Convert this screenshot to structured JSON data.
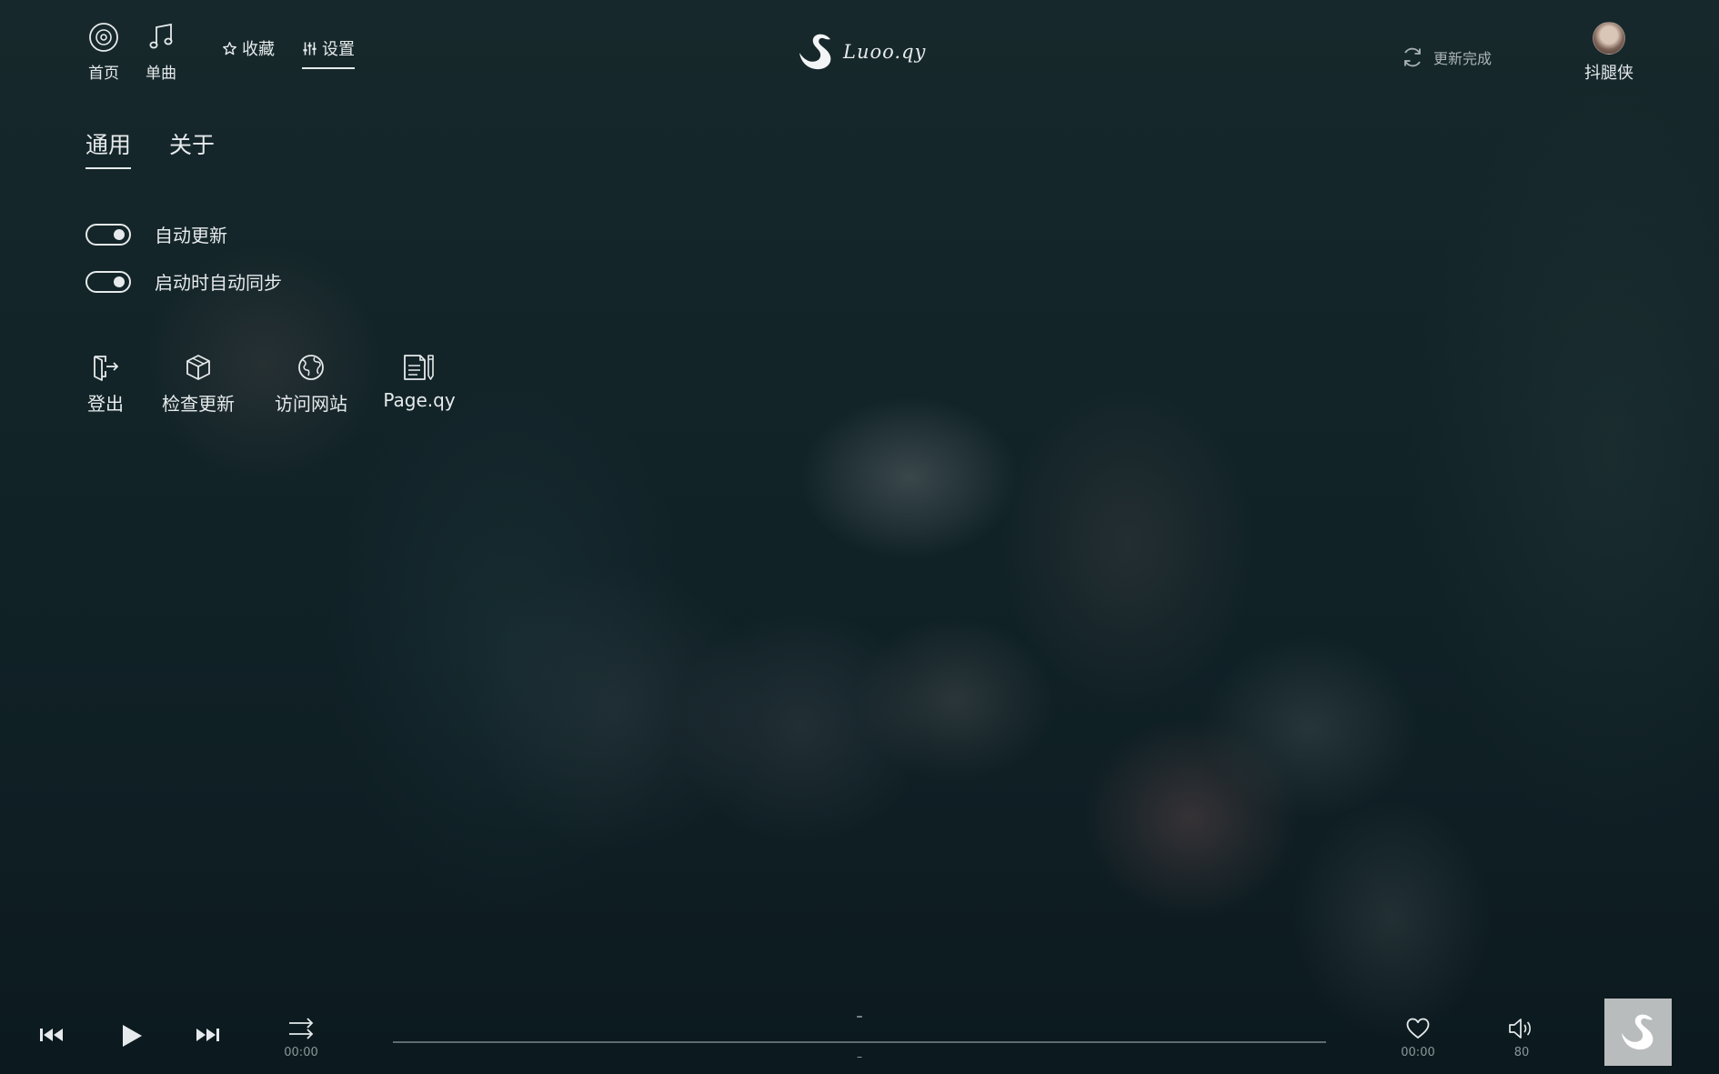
{
  "nav": {
    "home_label": "首页",
    "single_label": "单曲",
    "favorites_label": "收藏",
    "settings_label": "设置"
  },
  "logo": {
    "text": "Luoo.qy"
  },
  "update_status": {
    "text": "更新完成"
  },
  "user": {
    "name": "抖腿侠"
  },
  "tabs": [
    {
      "label": "通用",
      "active": true
    },
    {
      "label": "关于",
      "active": false
    }
  ],
  "toggles": [
    {
      "label": "自动更新",
      "on": true
    },
    {
      "label": "启动时自动同步",
      "on": true
    }
  ],
  "actions": [
    {
      "label": "登出",
      "icon": "logout-icon"
    },
    {
      "label": "检查更新",
      "icon": "package-icon"
    },
    {
      "label": "访问网站",
      "icon": "globe-icon"
    },
    {
      "label": "Page.qy",
      "icon": "document-pen-icon"
    }
  ],
  "player": {
    "track_title": "–",
    "track_artist": "–",
    "mode_time": "00:00",
    "like_time": "00:00",
    "volume": "80",
    "progress": 0
  },
  "colors": {
    "background": "#152125",
    "foreground": "#e6eaec",
    "muted": "#8c969a",
    "cover_bg": "#b9bcbd"
  }
}
